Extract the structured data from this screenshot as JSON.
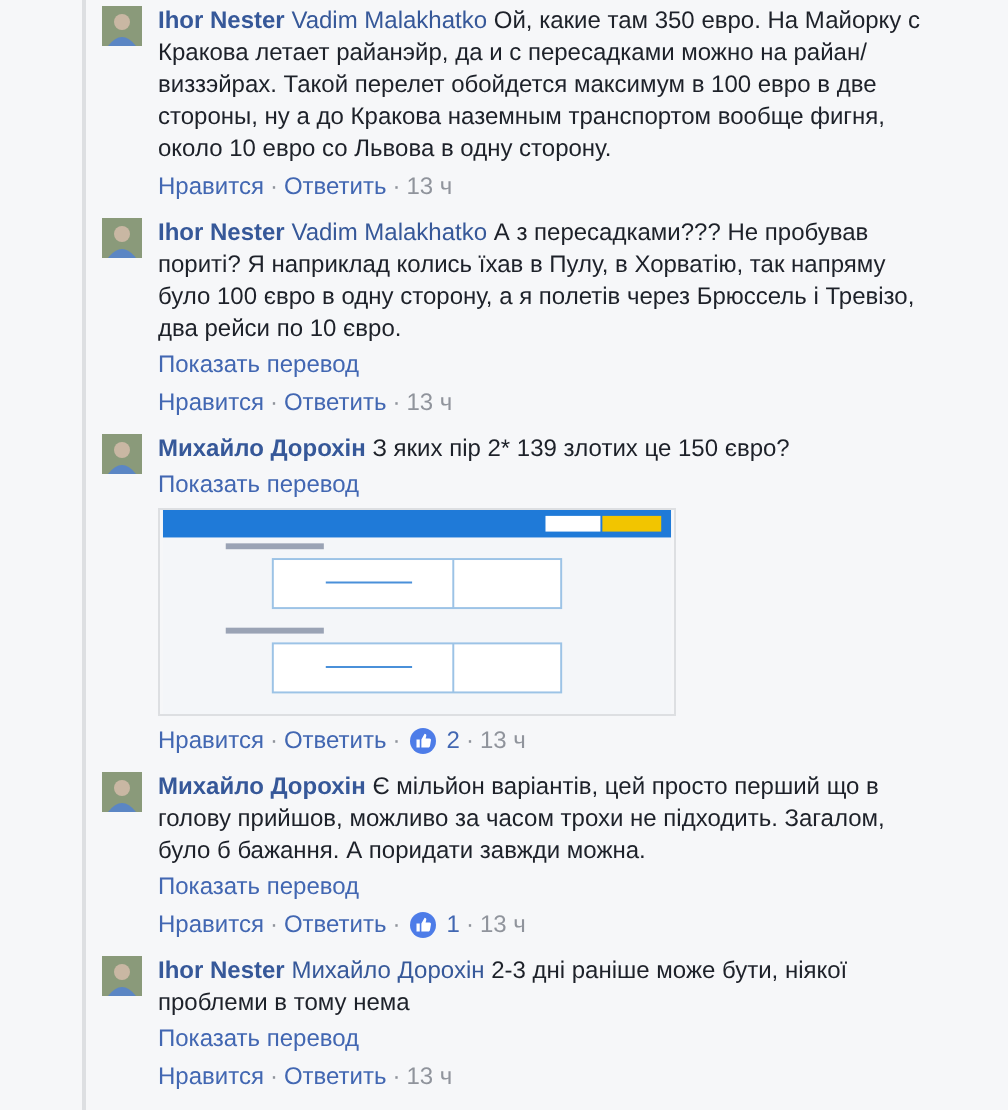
{
  "comments": [
    {
      "author": "Ihor Nester",
      "mention": "Vadim Malakhatko",
      "text": "Ой, какие там 350 евро. На Майорку с Кракова летает райанэйр, да и с пересадками можно на райан/виззэйрах. Такой перелет обойдется максимум в 100 евро в две стороны, ну а до Кракова наземным транспортом вообще фигня, около 10 евро со Львова в одну сторону.",
      "actions": [
        {
          "kind": "link",
          "text": "Нравится"
        },
        {
          "kind": "sep",
          "text": "·"
        },
        {
          "kind": "link",
          "text": "Ответить"
        },
        {
          "kind": "sep",
          "text": "·"
        },
        {
          "kind": "time",
          "text": "13 ч"
        }
      ]
    },
    {
      "author": "Ihor Nester",
      "mention": "Vadim Malakhatko",
      "text": "А з пересадками??? Не пробував пориті? Я наприклад колись їхав в Пулу, в Хорватію, так напряму було 100 євро в одну сторону, а я полетів через Брюссель і Тревізо, два рейси по 10 євро.",
      "translate": "Показать перевод",
      "actions": [
        {
          "kind": "link",
          "text": "Нравится"
        },
        {
          "kind": "sep",
          "text": "·"
        },
        {
          "kind": "link",
          "text": "Ответить"
        },
        {
          "kind": "sep",
          "text": "·"
        },
        {
          "kind": "time",
          "text": "13 ч"
        }
      ]
    },
    {
      "author": "Михайло Дорохін",
      "text": "З яких пір 2* 139 злотих це 150 євро?",
      "translate": "Показать перевод",
      "actions": [
        {
          "kind": "link",
          "text": "Нравится"
        },
        {
          "kind": "sep",
          "text": "·"
        },
        {
          "kind": "link",
          "text": "Ответить"
        },
        {
          "kind": "sep",
          "text": "·"
        },
        {
          "kind": "likes",
          "text": "2"
        },
        {
          "kind": "sep",
          "text": "·"
        },
        {
          "kind": "time",
          "text": "13 ч"
        }
      ]
    },
    {
      "author": "Михайло Дорохін",
      "text": "Є мільйон варіантів, цей просто перший що в голову прийшов, можливо за часом трохи не підходить. Загалом, було б бажання. А поридати завжди можна.",
      "translate": "Показать перевод",
      "actions": [
        {
          "kind": "link",
          "text": "Нравится"
        },
        {
          "kind": "sep",
          "text": "·"
        },
        {
          "kind": "link",
          "text": "Ответить"
        },
        {
          "kind": "sep",
          "text": "·"
        },
        {
          "kind": "likes",
          "text": "1"
        },
        {
          "kind": "sep",
          "text": "·"
        },
        {
          "kind": "time",
          "text": "13 ч"
        }
      ]
    },
    {
      "author": "Ihor Nester",
      "mention": "Михайло Дорохін",
      "text": "2-3 дні раніше може бути, ніякої проблеми в тому нема",
      "translate": "Показать перевод",
      "actions": [
        {
          "kind": "link",
          "text": "Нравится"
        },
        {
          "kind": "sep",
          "text": "·"
        },
        {
          "kind": "link",
          "text": "Ответить"
        },
        {
          "kind": "sep",
          "text": "·"
        },
        {
          "kind": "time",
          "text": "13 ч"
        }
      ]
    }
  ]
}
